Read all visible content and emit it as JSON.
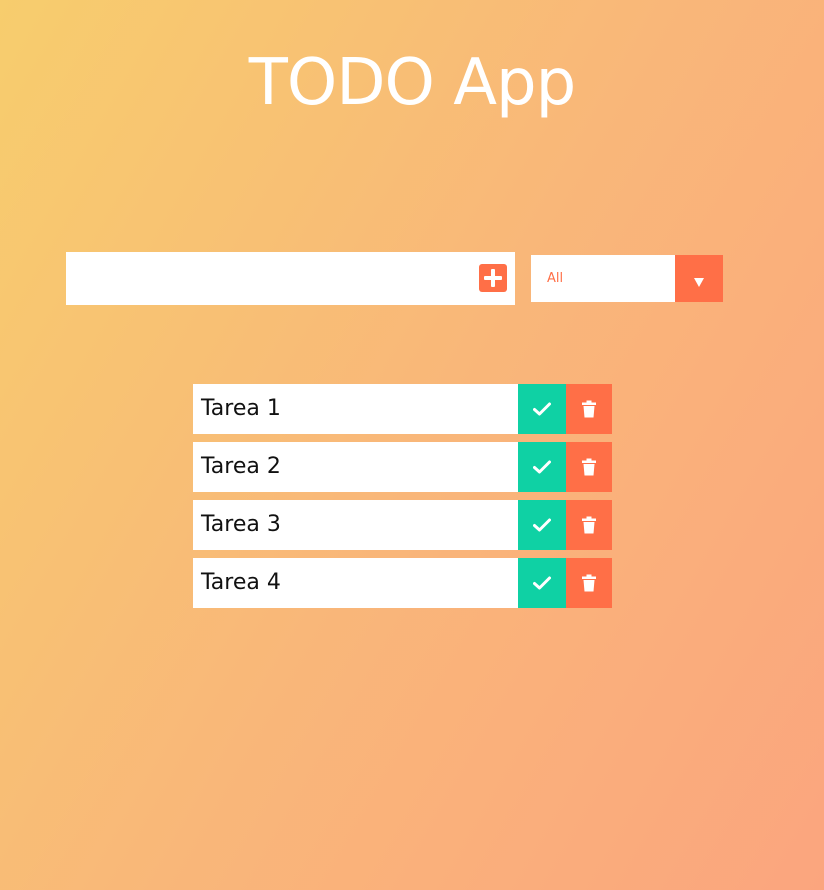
{
  "header": {
    "title": "TODO App"
  },
  "form": {
    "input_value": "",
    "input_placeholder": "",
    "add_icon": "plus-square-icon"
  },
  "filter": {
    "selected": "All",
    "arrow_icon": "caret-down-icon"
  },
  "todos": [
    {
      "text": "Tarea 1",
      "complete_icon": "check-icon",
      "delete_icon": "trash-icon"
    },
    {
      "text": "Tarea 2",
      "complete_icon": "check-icon",
      "delete_icon": "trash-icon"
    },
    {
      "text": "Tarea 3",
      "complete_icon": "check-icon",
      "delete_icon": "trash-icon"
    },
    {
      "text": "Tarea 4",
      "complete_icon": "check-icon",
      "delete_icon": "trash-icon"
    }
  ],
  "colors": {
    "accent": "#ff6f47",
    "complete": "#0fd1a4",
    "background_start": "#f7cd6d",
    "background_end": "#fba57e"
  }
}
